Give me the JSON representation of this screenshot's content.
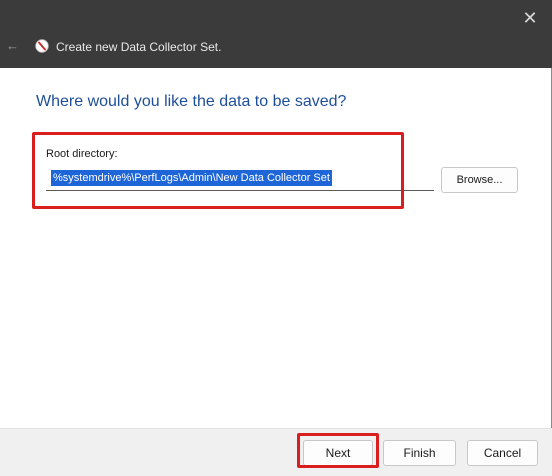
{
  "window": {
    "title": "Create new Data Collector Set.",
    "close_glyph": "✕",
    "back_glyph": "←"
  },
  "page": {
    "heading": "Where would you like the data to be saved?",
    "root_directory_label": "Root directory:",
    "root_directory_value": "%systemdrive%\\PerfLogs\\Admin\\New Data Collector Set",
    "browse_label": "Browse..."
  },
  "footer": {
    "next_label": "Next",
    "finish_label": "Finish",
    "cancel_label": "Cancel"
  },
  "colors": {
    "titlebar": "#3b3b3b",
    "heading": "#1f4e99",
    "selection": "#1e66d8",
    "annotation_highlight": "#d81e1e"
  },
  "icons": {
    "app": "performance-monitor-icon",
    "back": "back-arrow-icon",
    "close": "close-icon"
  }
}
